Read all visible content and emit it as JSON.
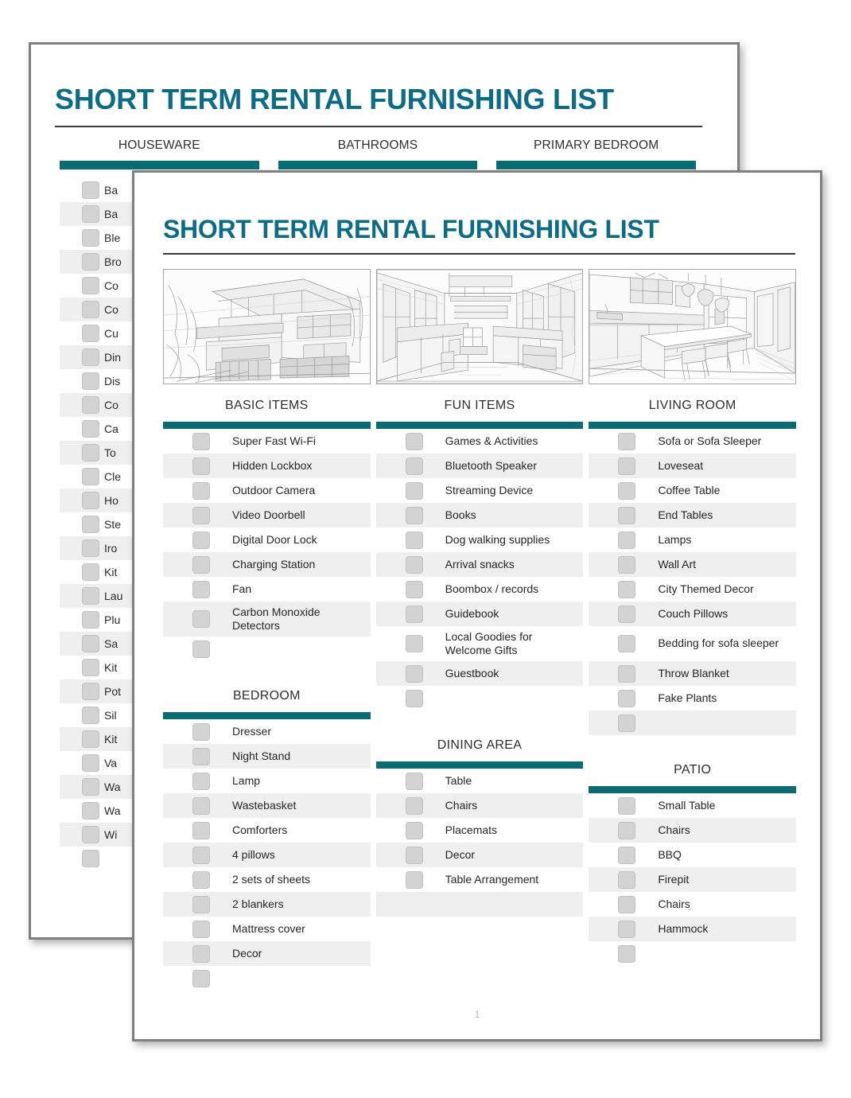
{
  "document": {
    "title": "SHORT TERM RENTAL FURNISHING LIST",
    "page_number": "1",
    "accent_color": "#0b6b72",
    "title_color": "#0d6c85"
  },
  "back_page": {
    "title": "SHORT TERM RENTAL FURNISHING LIST",
    "columns": [
      {
        "heading": "HOUSEWARE"
      },
      {
        "heading": "BATHROOMS"
      },
      {
        "heading": "PRIMARY BEDROOM"
      }
    ],
    "visible_items": [
      "Ba",
      "Ba",
      "Ble",
      "Bro",
      "Co",
      "Co",
      "Cu",
      "Din",
      "Dis",
      "Co",
      "Ca",
      "To",
      "Cle",
      "Ho",
      "Ste",
      "Iro",
      "Kit",
      "Lau",
      "Plu",
      "Sa",
      "Kit",
      "Pot",
      "Sil",
      "Kit",
      "Va",
      "Wa",
      "Wa",
      "Wi",
      ""
    ]
  },
  "front_page": {
    "title": "SHORT TERM RENTAL FURNISHING LIST",
    "images": [
      {
        "name": "house-exterior-sketch",
        "caption": "Pencil sketch of modern hillside house exterior"
      },
      {
        "name": "interior-room-sketch",
        "caption": "Pencil sketch of open interior with desks and windows"
      },
      {
        "name": "kitchen-sketch",
        "caption": "Pencil sketch of kitchen with island and stools"
      }
    ],
    "sections": [
      {
        "heading": "BASIC ITEMS",
        "items": [
          "Super Fast Wi-Fi",
          "Hidden Lockbox",
          "Outdoor Camera",
          "Video Doorbell",
          "Digital Door Lock",
          "Charging Station",
          "Fan",
          "Carbon Monoxide Detectors",
          ""
        ]
      },
      {
        "heading": "FUN ITEMS",
        "items": [
          "Games & Activities",
          "Bluetooth Speaker",
          "Streaming Device",
          "Books",
          "Dog walking supplies",
          "Arrival snacks",
          "Boombox / records",
          "Guidebook",
          "Local Goodies for Welcome Gifts",
          "Guestbook",
          ""
        ]
      },
      {
        "heading": "LIVING ROOM",
        "items": [
          "Sofa or Sofa Sleeper",
          "Loveseat",
          "Coffee Table",
          "End Tables",
          "Lamps",
          "Wall Art",
          "City Themed Decor",
          "Couch Pillows",
          "Bedding for sofa sleeper",
          "Throw Blanket",
          "Fake Plants",
          ""
        ]
      },
      {
        "heading": "BEDROOM",
        "items": [
          "Dresser",
          "Night Stand",
          "Lamp",
          "Wastebasket",
          "Comforters",
          "4 pillows",
          "2 sets of sheets",
          "2 blankers",
          "Mattress cover",
          "Decor",
          ""
        ]
      },
      {
        "heading": "DINING AREA",
        "items": [
          "Table",
          "Chairs",
          "Placemats",
          "Decor",
          "Table Arrangement"
        ]
      },
      {
        "heading": "PATIO",
        "items": [
          "Small Table",
          "Chairs",
          "BBQ",
          "Firepit",
          "Chairs",
          "Hammock",
          ""
        ]
      }
    ]
  }
}
